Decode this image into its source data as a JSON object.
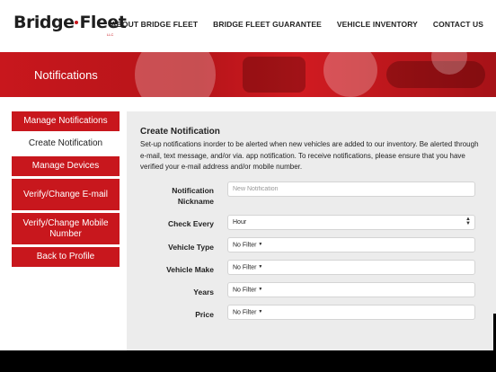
{
  "header": {
    "logo_text": "Bridge·Fleet",
    "logo_left": "Bridge",
    "logo_right": "Fleet",
    "logo_llc": "LLC",
    "nav": [
      "ABOUT BRIDGE FLEET",
      "BRIDGE FLEET GUARANTEE",
      "VEHICLE INVENTORY",
      "CONTACT US"
    ]
  },
  "banner": {
    "title": "Notifications"
  },
  "sidebar": {
    "items": [
      {
        "label": "Manage Notifications"
      },
      {
        "label": "Create Notification"
      },
      {
        "label": "Manage Devices"
      },
      {
        "label": "Verify/Change E-mail"
      },
      {
        "label": "Verify/Change Mobile Number"
      },
      {
        "label": "Back to Profile"
      }
    ]
  },
  "form": {
    "title": "Create Notification",
    "description": "Set-up notifications inorder to be alerted when new vehicles are added to our inventory. Be alerted through e-mail, text message, and/or via. app notification. To receive notifications, please ensure that you have verified your e-mail address and/or mobile number.",
    "nickname_label": "Notification Nickname",
    "nickname_placeholder": "New Notification",
    "check_every_label": "Check Every",
    "check_every_value": "Hour",
    "vehicle_type_label": "Vehicle Type",
    "vehicle_type_value": "No Filter",
    "vehicle_make_label": "Vehicle Make",
    "vehicle_make_value": "No Filter",
    "years_label": "Years",
    "years_value": "No Filter",
    "price_label": "Price",
    "price_value": "No Filter"
  },
  "colors": {
    "brand_red": "#c8171d",
    "panel_gray": "#ececec"
  }
}
